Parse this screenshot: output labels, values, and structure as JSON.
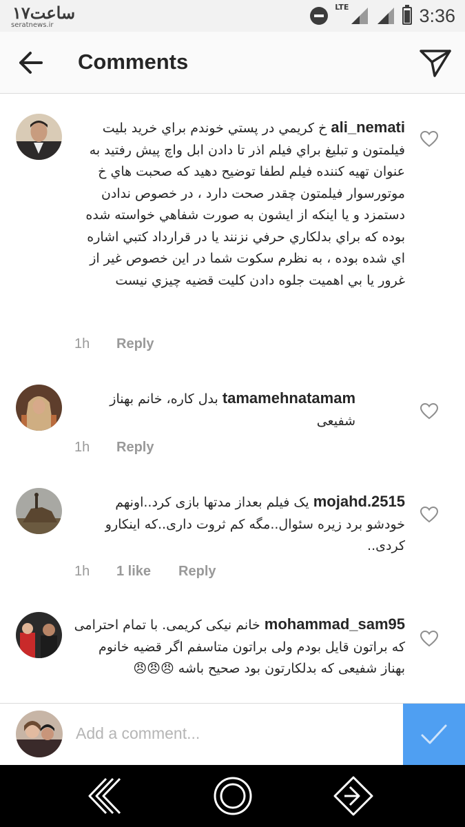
{
  "status_bar": {
    "watermark_logo": "۱۷ساعت",
    "watermark_url": "seratnews.ir",
    "network": "LTE",
    "time": "3:36",
    "icons": [
      "do-not-disturb-icon",
      "signal-lte-icon",
      "signal-icon",
      "battery-icon"
    ]
  },
  "header": {
    "title": "Comments",
    "back_icon": "arrow-left-icon",
    "direct_icon": "paper-plane-icon"
  },
  "comments": [
    {
      "username": "ali_nemati",
      "text": "خ كريمي در پستي خوندم براي خريد بليت فيلمتون و تبليغ براي فيلم اذر تا دادن ابل واچ پيش رفتيد به عنوان تهيه كننده فيلم لطفا توضيح دهيد كه صحبت هاي خ موتورسوار فيلمتون چقدر صحت دارد ، در خصوص ندادن دستمزد و يا اينكه از ايشون به صورت شفاهي خواسته شده بوده كه براي بدلكاري حرفي نزنند يا در قرارداد كتبي اشاره اي شده بوده ، به نظرم سكوت شما در اين خصوص غير از غرور يا بي اهميت جلوه دادن كليت قضيه چيزي نيست",
      "time": "1h",
      "likes": "",
      "reply": "Reply"
    },
    {
      "username": "tamamehnatamam",
      "text": "بدل کاره، خانم بهناز شفیعی",
      "time": "1h",
      "likes": "",
      "reply": "Reply"
    },
    {
      "username": "mojahd.2515",
      "text": "یک فیلم بعداز مدتها بازی کرد..اونهم خودشو برد زیره سئوال..مگه کم ثروت داری..که اینکارو کردی..",
      "time": "1h",
      "likes": "1 like",
      "reply": "Reply"
    },
    {
      "username": "mohammad_sam95",
      "text": "خانم نیکی کریمی. با تمام احترامی که براتون قایل بودم ولی براتون متاسفم اگر قضیه خانوم بهناز شفیعی که بدلکارتون بود صحیح باشه 😠😠😠",
      "time": "1h",
      "likes": "",
      "reply": "Reply"
    }
  ],
  "composer": {
    "placeholder": "Add a comment...",
    "post_icon": "checkmark-icon"
  },
  "nav_bar": {
    "icons": [
      "nav-back-icon",
      "nav-home-icon",
      "nav-recents-icon"
    ]
  },
  "colors": {
    "accent": "#4f9ff2",
    "text": "#262626",
    "meta": "#999999",
    "divider": "#dbdbdb"
  }
}
